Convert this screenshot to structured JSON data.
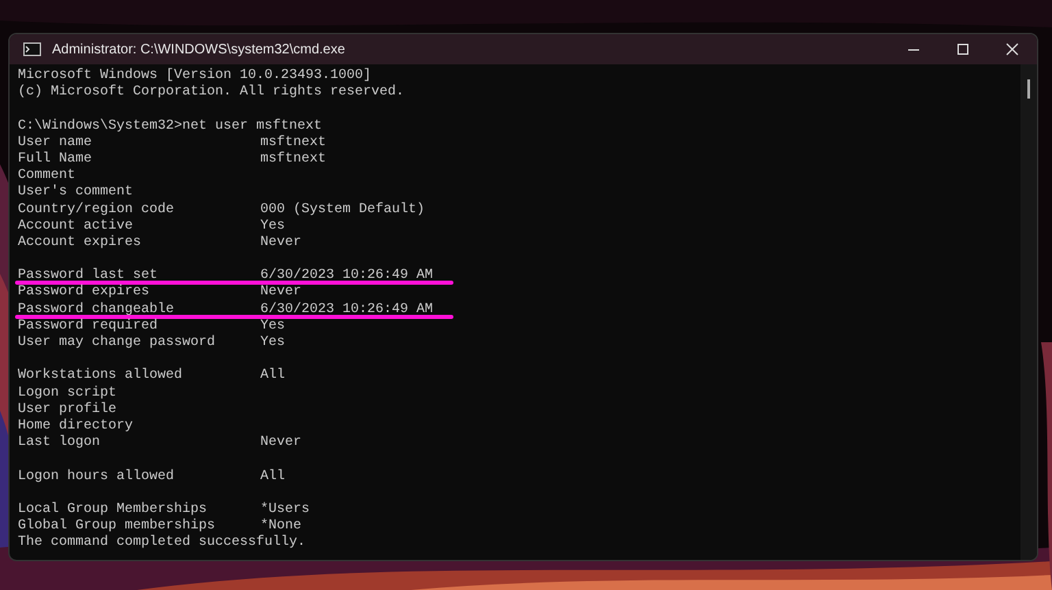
{
  "window": {
    "title": "Administrator: C:\\WINDOWS\\system32\\cmd.exe"
  },
  "console": {
    "lines": [
      {
        "kind": "text",
        "text": "Microsoft Windows [Version 10.0.23493.1000]",
        "underlined": false
      },
      {
        "kind": "text",
        "text": "(c) Microsoft Corporation. All rights reserved.",
        "underlined": false
      },
      {
        "kind": "blank",
        "underlined": false
      },
      {
        "kind": "text",
        "text": "C:\\Windows\\System32>net user msftnext",
        "underlined": false
      },
      {
        "kind": "field",
        "label": "User name",
        "value": "msftnext",
        "underlined": false
      },
      {
        "kind": "field",
        "label": "Full Name",
        "value": "msftnext",
        "underlined": false
      },
      {
        "kind": "field",
        "label": "Comment",
        "underlined": false
      },
      {
        "kind": "field",
        "label": "User's comment",
        "underlined": false
      },
      {
        "kind": "field",
        "label": "Country/region code",
        "value": "000 (System Default)",
        "underlined": false
      },
      {
        "kind": "field",
        "label": "Account active",
        "value": "Yes",
        "underlined": false
      },
      {
        "kind": "field",
        "label": "Account expires",
        "value": "Never",
        "underlined": false
      },
      {
        "kind": "blank",
        "underlined": false
      },
      {
        "kind": "field",
        "label": "Password last set",
        "value": "6/30/2023 10:26:49 AM",
        "underlined": true
      },
      {
        "kind": "field",
        "label": "Password expires",
        "value": "Never",
        "underlined": false
      },
      {
        "kind": "field",
        "label": "Password changeable",
        "value": "6/30/2023 10:26:49 AM",
        "underlined": true
      },
      {
        "kind": "field",
        "label": "Password required",
        "value": "Yes",
        "underlined": false
      },
      {
        "kind": "field",
        "label": "User may change password",
        "value": "Yes",
        "underlined": false
      },
      {
        "kind": "blank",
        "underlined": false
      },
      {
        "kind": "field",
        "label": "Workstations allowed",
        "value": "All",
        "underlined": false
      },
      {
        "kind": "field",
        "label": "Logon script",
        "underlined": false
      },
      {
        "kind": "field",
        "label": "User profile",
        "underlined": false
      },
      {
        "kind": "field",
        "label": "Home directory",
        "underlined": false
      },
      {
        "kind": "field",
        "label": "Last logon",
        "value": "Never",
        "underlined": false
      },
      {
        "kind": "blank",
        "underlined": false
      },
      {
        "kind": "field",
        "label": "Logon hours allowed",
        "value": "All",
        "underlined": false
      },
      {
        "kind": "blank",
        "underlined": false
      },
      {
        "kind": "field",
        "label": "Local Group Memberships",
        "value": "*Users",
        "underlined": false
      },
      {
        "kind": "field",
        "label": "Global Group memberships",
        "value": "*None",
        "underlined": false
      },
      {
        "kind": "text",
        "text": "The command completed successfully.",
        "underlined": false
      }
    ]
  }
}
